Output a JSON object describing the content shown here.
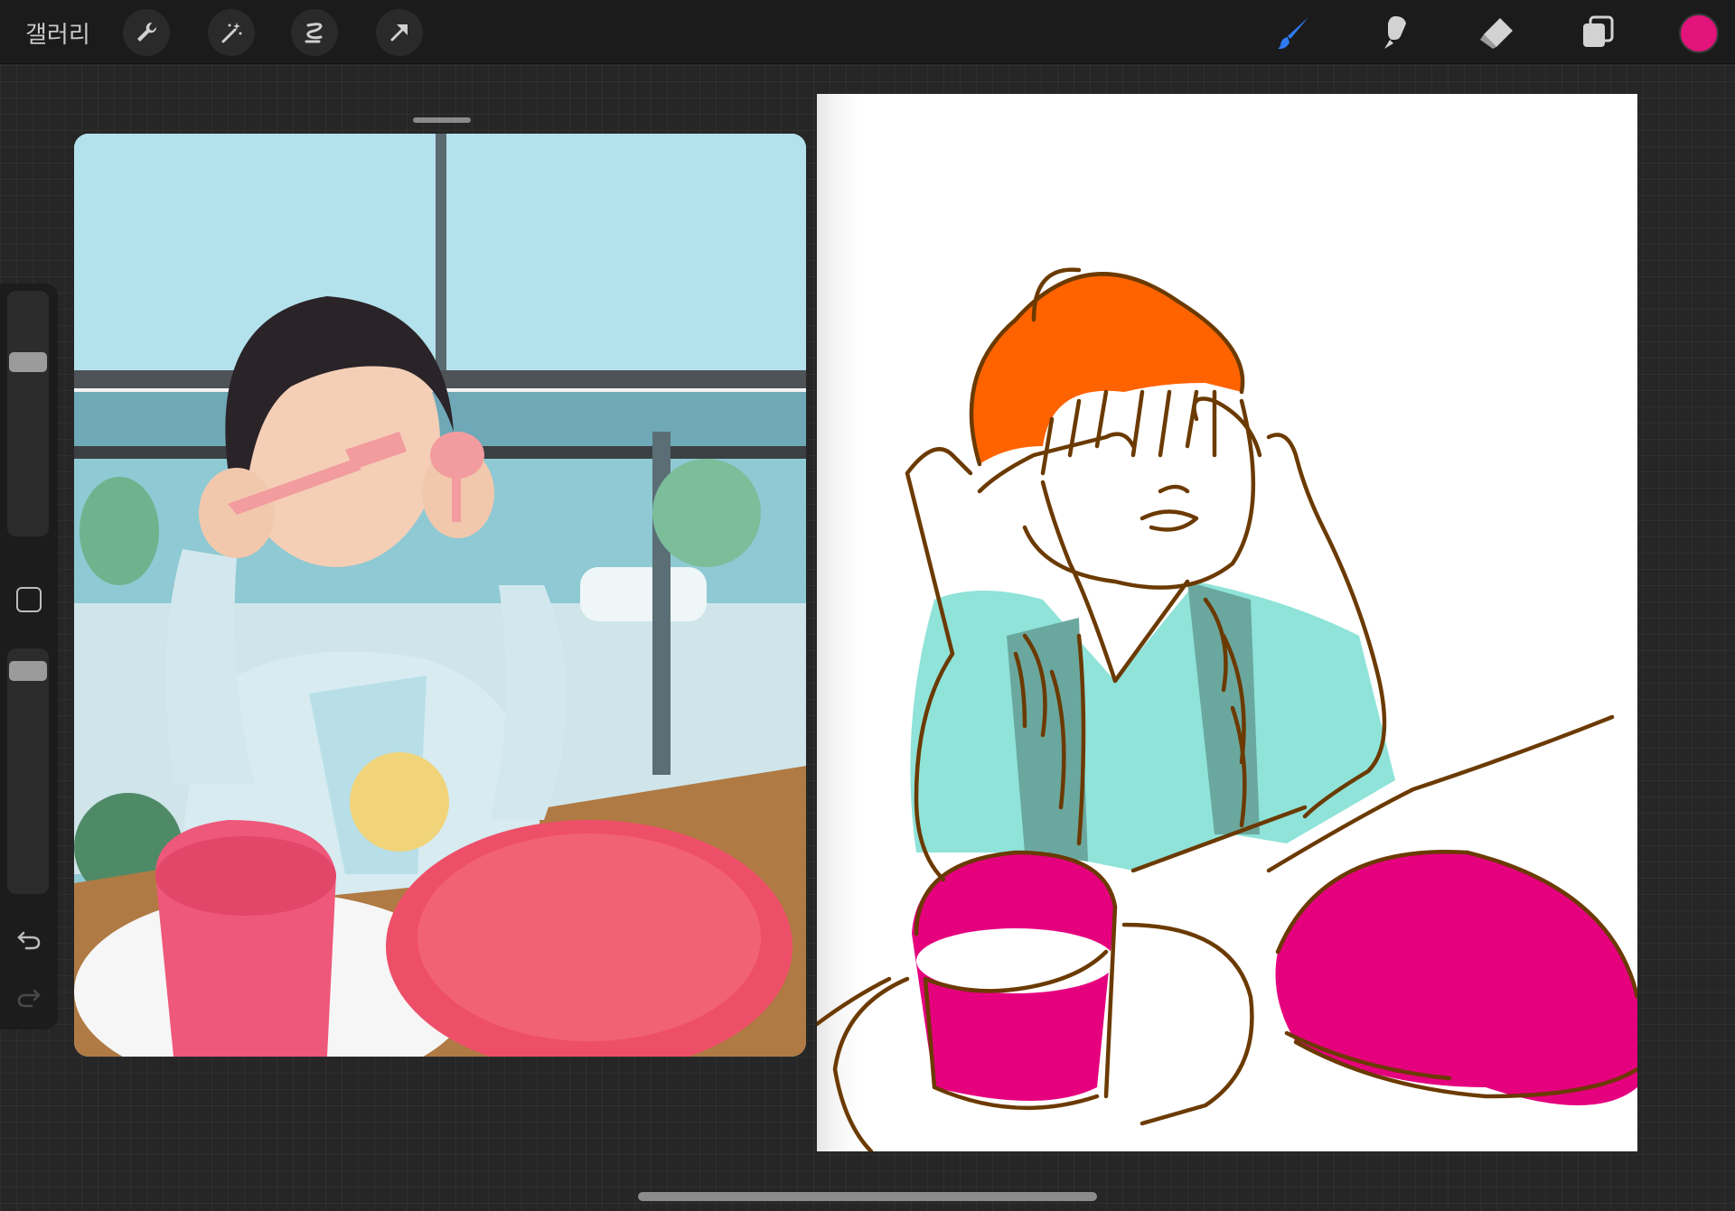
{
  "toolbar": {
    "gallery_label": "갤러리",
    "left_icons": [
      "wrench-icon",
      "magic-wand-icon",
      "selection-icon",
      "transform-arrow-icon"
    ],
    "right_icons": [
      "brush-icon",
      "smudge-icon",
      "eraser-icon",
      "layers-icon"
    ],
    "active_tool": "brush",
    "accent_color": "#2f7bf5",
    "current_color": "#e2137a"
  },
  "sidebar": {
    "brush_size_level": 0.25,
    "opacity_level": 0.05,
    "icons": [
      "modify-square-icon",
      "undo-icon",
      "redo-icon"
    ]
  },
  "reference_window": {
    "subject": "photo-of-child-with-spoon-and-fork",
    "colors": {
      "shirt": "#c9e4ee",
      "cup": "#f0587a",
      "plate": "#ee4f68",
      "window": "#9fd9e6"
    }
  },
  "drawing": {
    "colors": {
      "stroke": "#6b3a00",
      "hair": "#ff6300",
      "shirt": "#8fe3d9",
      "ruffle": "#6aa89f",
      "dishes": "#e5007e"
    }
  }
}
